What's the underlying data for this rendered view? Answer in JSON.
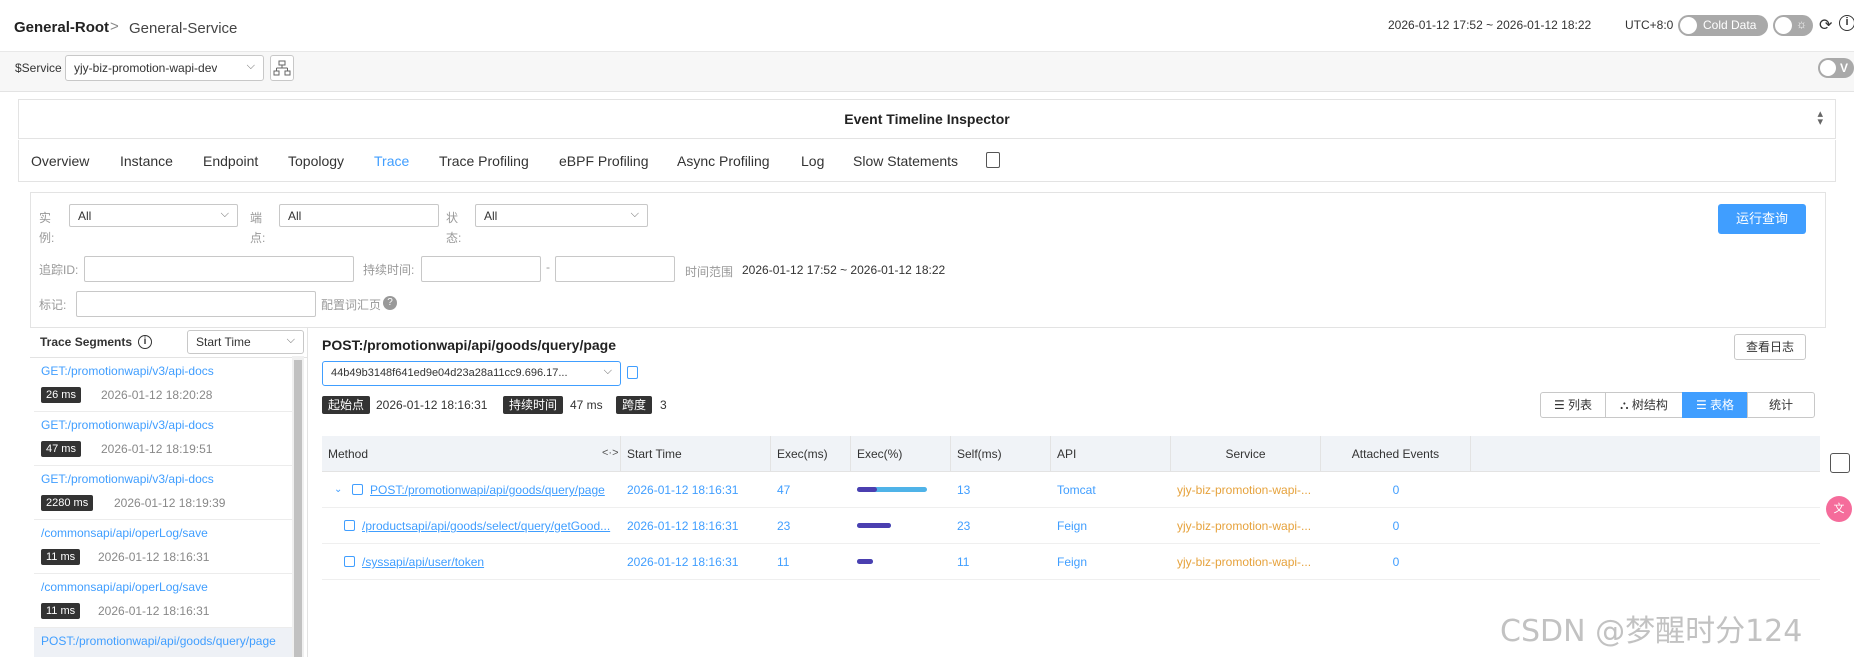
{
  "header": {
    "breadcrumb_root": "General-Root",
    "breadcrumb_separator": ">",
    "breadcrumb_service": "General-Service",
    "time_range": "2026-01-12 17:52 ~ 2026-01-12 18:22",
    "timezone": "UTC+8:0",
    "cold_data_label": "Cold Data"
  },
  "service_bar": {
    "label": "$Service",
    "selected": "yjy-biz-promotion-wapi-dev",
    "right_toggle_label": "V"
  },
  "panel": {
    "title": "Event Timeline Inspector"
  },
  "tabs": [
    {
      "label": "Overview"
    },
    {
      "label": "Instance"
    },
    {
      "label": "Endpoint"
    },
    {
      "label": "Topology"
    },
    {
      "label": "Trace"
    },
    {
      "label": "Trace Profiling"
    },
    {
      "label": "eBPF Profiling"
    },
    {
      "label": "Async Profiling"
    },
    {
      "label": "Log"
    },
    {
      "label": "Slow Statements"
    }
  ],
  "filters": {
    "instance_label_1": "实",
    "instance_label_2": "例:",
    "instance_value": "All",
    "endpoint_label_1": "端",
    "endpoint_label_2": "点:",
    "endpoint_value": "All",
    "status_label_1": "状",
    "status_label_2": "态:",
    "status_value": "All",
    "trace_id_label": "追踪ID:",
    "duration_label": "持续时间:",
    "duration_sep": "-",
    "time_range_label": "时间范围",
    "time_range_value": "2026-01-12 17:52 ~ 2026-01-12 18:22",
    "tags_label": "标记:",
    "config_label": "配置词汇页",
    "run_button": "运行查询"
  },
  "segments": {
    "title": "Trace Segments",
    "sort_value": "Start Time",
    "items": [
      {
        "path": "GET:/promotionwapi/v3/api-docs",
        "duration": "26 ms",
        "time": "2026-01-12 18:20:28"
      },
      {
        "path": "GET:/promotionwapi/v3/api-docs",
        "duration": "47 ms",
        "time": "2026-01-12 18:19:51"
      },
      {
        "path": "GET:/promotionwapi/v3/api-docs",
        "duration": "2280 ms",
        "time": "2026-01-12 18:19:39"
      },
      {
        "path": "/commonsapi/api/operLog/save",
        "duration": "11 ms",
        "time": "2026-01-12 18:16:31"
      },
      {
        "path": "/commonsapi/api/operLog/save",
        "duration": "11 ms",
        "time": "2026-01-12 18:16:31"
      },
      {
        "path": "POST:/promotionwapi/api/goods/query/page",
        "duration": "",
        "time": ""
      }
    ]
  },
  "trace": {
    "title": "POST:/promotionwapi/api/goods/query/page",
    "trace_id": "44b49b3148f641ed9e04d23a28a11cc9.696.17...",
    "start_label": "起始点",
    "start_value": "2026-01-12 18:16:31",
    "duration_label": "持续时间",
    "duration_value": "47 ms",
    "span_label": "跨度",
    "span_value": "3",
    "view_log_button": "查看日志",
    "views": [
      "列表",
      "树结构",
      "表格",
      "统计"
    ]
  },
  "table": {
    "columns": [
      "Method",
      "Start Time",
      "Exec(ms)",
      "Exec(%)",
      "Self(ms)",
      "API",
      "Service",
      "Attached Events"
    ],
    "method_toggle": "<·>",
    "rows": [
      {
        "method": "POST:/promotionwapi/api/goods/query/page",
        "start": "2026-01-12 18:16:31",
        "exec": "47",
        "exec_pct": 100,
        "self_pct": 28,
        "self": "13",
        "api": "Tomcat",
        "service": "yjy-biz-promotion-wapi-...",
        "events": "0"
      },
      {
        "method": "/productsapi/api/goods/select/query/getGood...",
        "start": "2026-01-12 18:16:31",
        "exec": "23",
        "exec_pct": 49,
        "self_pct": 49,
        "self": "23",
        "api": "Feign",
        "service": "yjy-biz-promotion-wapi-...",
        "events": "0"
      },
      {
        "method": "/syssapi/api/user/token",
        "start": "2026-01-12 18:16:31",
        "exec": "11",
        "exec_pct": 23,
        "self_pct": 23,
        "self": "11",
        "api": "Feign",
        "service": "yjy-biz-promotion-wapi-...",
        "events": "0"
      }
    ]
  },
  "watermark": "CSDN @梦醒时分124"
}
